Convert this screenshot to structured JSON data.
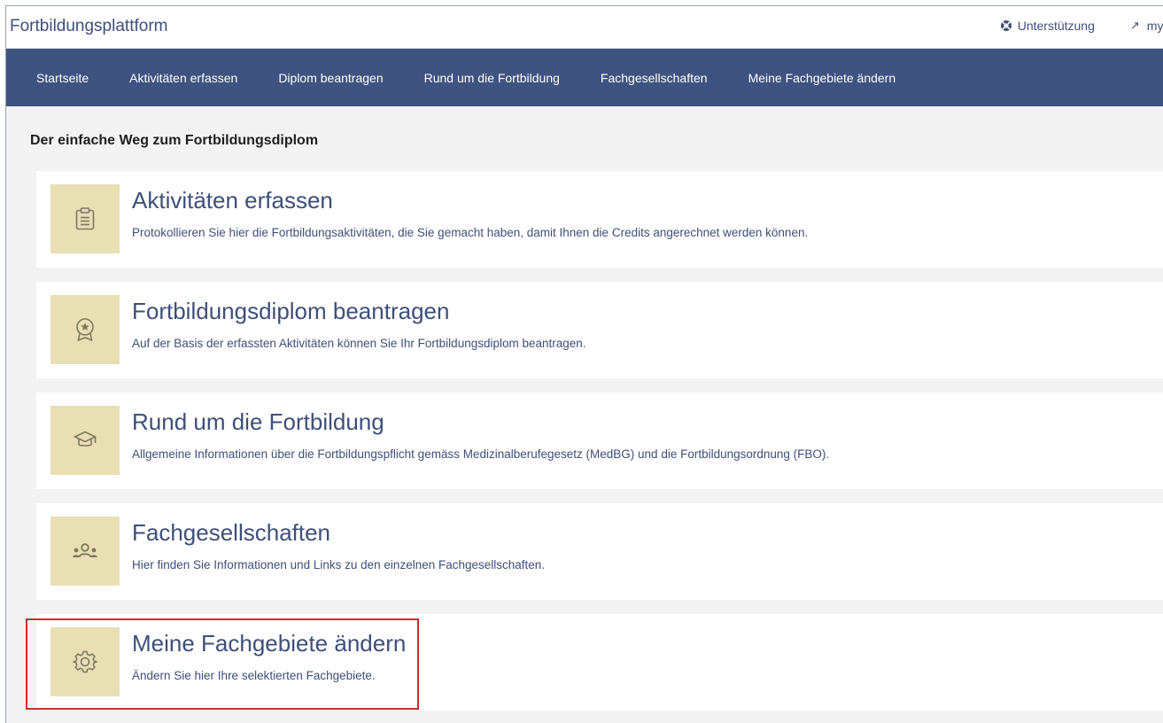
{
  "header": {
    "app_title": "Fortbildungsplattform",
    "support_label": "Unterstützung",
    "support_icon": "lifebuoy-icon",
    "external_label": "myF",
    "external_icon": "external-arrow-icon"
  },
  "nav": {
    "items": [
      {
        "label": "Startseite"
      },
      {
        "label": "Aktivitäten erfassen"
      },
      {
        "label": "Diplom beantragen"
      },
      {
        "label": "Rund um die Fortbildung"
      },
      {
        "label": "Fachgesellschaften"
      },
      {
        "label": "Meine Fachgebiete ändern"
      }
    ]
  },
  "main": {
    "heading": "Der einfache Weg zum Fortbildungsdiplom",
    "cards": [
      {
        "title": "Aktivitäten erfassen",
        "description": "Protokollieren Sie hier die Fortbildungsaktivitäten, die Sie gemacht haben, damit Ihnen die Credits angerechnet werden können.",
        "icon": "clipboard-icon"
      },
      {
        "title": "Fortbildungsdiplom beantragen",
        "description": "Auf der Basis der erfassten Aktivitäten können Sie Ihr Fortbildungsdiplom beantragen.",
        "icon": "award-badge-icon"
      },
      {
        "title": "Rund um die Fortbildung",
        "description": "Allgemeine Informationen über die Fortbildungspflicht gemäss Medizinalberufegesetz (MedBG) und die Fortbildungsordnung (FBO).",
        "icon": "graduation-cap-icon"
      },
      {
        "title": "Fachgesellschaften",
        "description": "Hier finden Sie Informationen und Links zu den einzelnen Fachgesellschaften.",
        "icon": "people-group-icon"
      },
      {
        "title": "Meine Fachgebiete ändern",
        "description": "Ändern Sie hier Ihre selektierten Fachgebiete.",
        "icon": "gear-icon"
      }
    ]
  },
  "colors": {
    "nav_background": "#3e5380",
    "text_primary": "#3e4f79",
    "icon_tile": "#e8dfb4",
    "icon_stroke": "#7c7961",
    "highlight": "#d42b2b"
  }
}
